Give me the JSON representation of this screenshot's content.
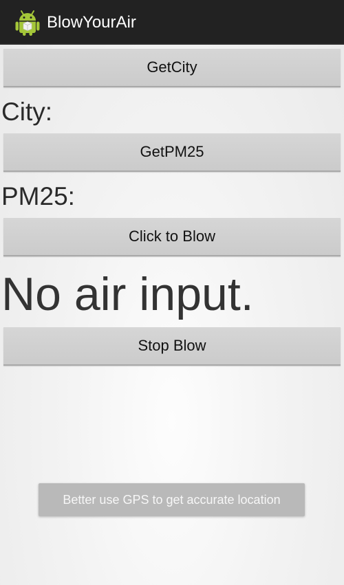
{
  "app": {
    "title": "BlowYourAir",
    "icon": "android-robot-icon"
  },
  "colors": {
    "action_bar": "#222222",
    "button_bg": "#d0d0d0",
    "toast_bg": "#b9b9b9"
  },
  "buttons": {
    "get_city": "GetCity",
    "get_pm25": "GetPM25",
    "click_to_blow": "Click to Blow",
    "stop_blow": "Stop Blow"
  },
  "labels": {
    "city": "City:",
    "pm25": "PM25:"
  },
  "status": {
    "text": "No air input."
  },
  "toast": {
    "message": "Better use GPS to get accurate location"
  }
}
